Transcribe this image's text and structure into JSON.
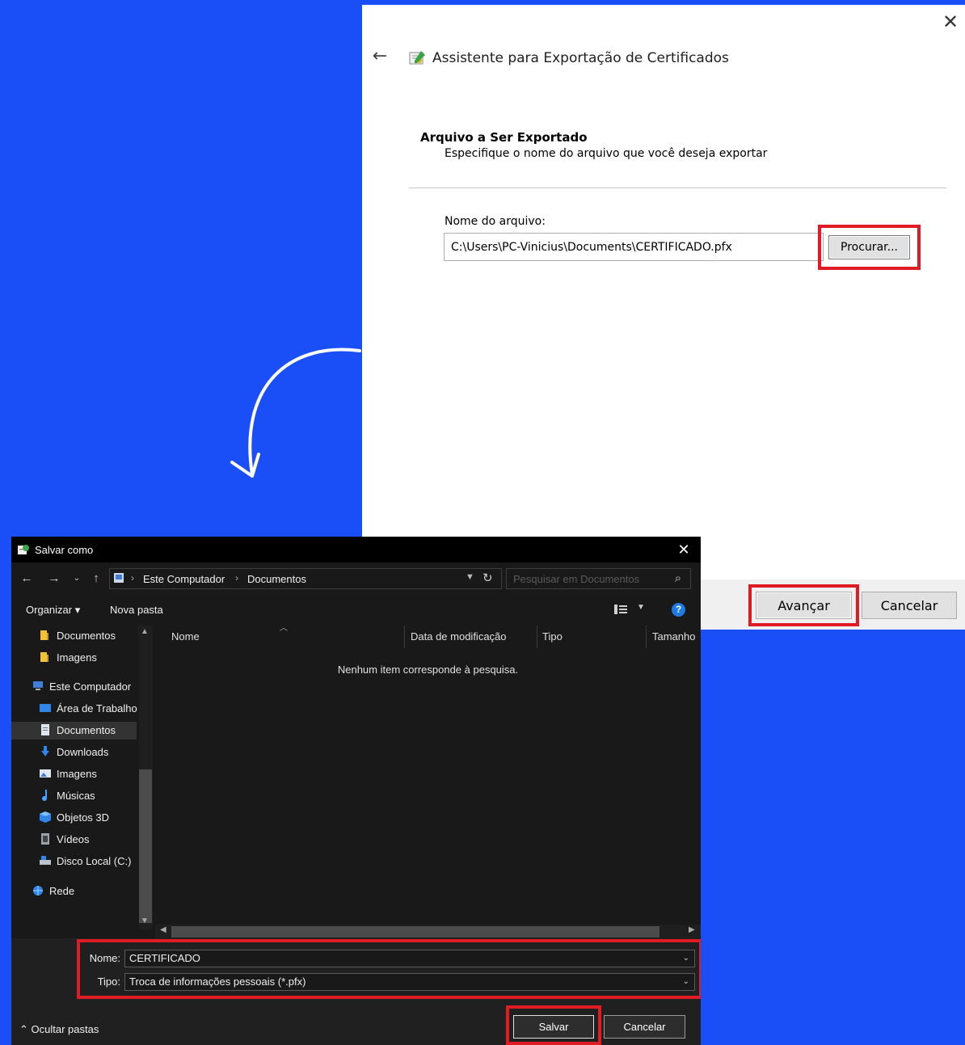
{
  "wizard": {
    "title": "Assistente para Exportação de Certificados",
    "section_title": "Arquivo a Ser Exportado",
    "section_subtitle": "Especifique o nome do arquivo que você deseja exportar",
    "file_label": "Nome do arquivo:",
    "file_value": "C:\\Users\\PC-Vinicius\\Documents\\CERTIFICADO.pfx",
    "browse_label": "Procurar...",
    "next_label": "Avançar",
    "cancel_label": "Cancelar",
    "close_glyph": "✕",
    "back_glyph": "←"
  },
  "save_dialog": {
    "title": "Salvar como",
    "close_glyph": "✕",
    "breadcrumb": [
      "Este Computador",
      "Documentos"
    ],
    "search_placeholder": "Pesquisar em Documentos",
    "toolbar": {
      "organize": "Organizar ▾",
      "new_folder": "Nova pasta"
    },
    "nav_items": [
      {
        "label": "Documentos",
        "icon": "folder-icon"
      },
      {
        "label": "Imagens",
        "icon": "folder-icon"
      },
      {
        "label": "Este Computador",
        "icon": "computer-icon"
      },
      {
        "label": "Área de Trabalho",
        "icon": "desktop-icon"
      },
      {
        "label": "Documentos",
        "icon": "documents-icon"
      },
      {
        "label": "Downloads",
        "icon": "download-icon"
      },
      {
        "label": "Imagens",
        "icon": "pictures-icon"
      },
      {
        "label": "Músicas",
        "icon": "music-icon"
      },
      {
        "label": "Objetos 3D",
        "icon": "cube-icon"
      },
      {
        "label": "Vídeos",
        "icon": "video-icon"
      },
      {
        "label": "Disco Local (C:)",
        "icon": "drive-icon"
      },
      {
        "label": "Rede",
        "icon": "network-icon"
      }
    ],
    "columns": [
      "Nome",
      "Data de modificação",
      "Tipo",
      "Tamanho"
    ],
    "empty_message": "Nenhum item corresponde à pesquisa.",
    "name_label": "Nome:",
    "name_value": "CERTIFICADO",
    "type_label": "Tipo:",
    "type_value": "Troca de informações pessoais (*.pfx)",
    "hide_folders": "Ocultar pastas",
    "save_label": "Salvar",
    "cancel_label": "Cancelar"
  },
  "colors": {
    "background": "#1a4ff7",
    "highlight": "#e01b24",
    "dialog_dark": "#191919"
  }
}
